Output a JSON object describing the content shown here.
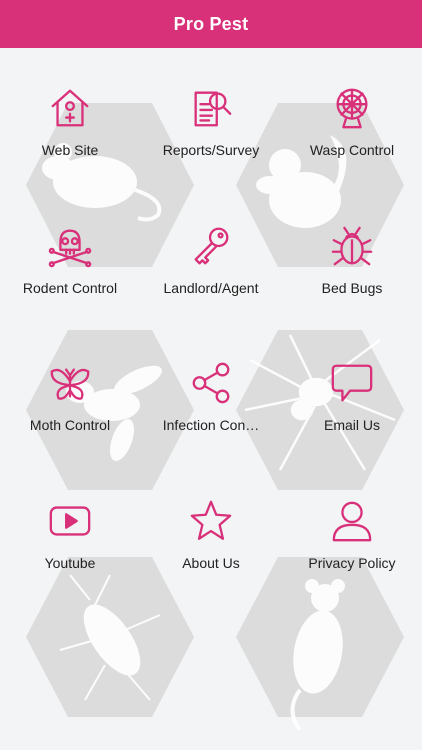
{
  "app": {
    "title": "Pro Pest"
  },
  "colors": {
    "accent": "#d9307a",
    "background": "#f2f4f5",
    "hexagon": "#dcdcdc"
  },
  "menu": [
    {
      "label": "Web Site",
      "icon": "house-icon"
    },
    {
      "label": "Reports/Survey",
      "icon": "report-search-icon"
    },
    {
      "label": "Wasp Control",
      "icon": "ferris-wheel-icon"
    },
    {
      "label": "Rodent Control",
      "icon": "skull-crossbones-icon"
    },
    {
      "label": "Landlord/Agent",
      "icon": "key-icon"
    },
    {
      "label": "Bed Bugs",
      "icon": "bug-icon"
    },
    {
      "label": "Moth Control",
      "icon": "butterfly-icon"
    },
    {
      "label": "Infection Con…",
      "icon": "share-icon"
    },
    {
      "label": "Email Us",
      "icon": "speech-bubble-icon"
    },
    {
      "label": "Youtube",
      "icon": "youtube-icon"
    },
    {
      "label": "About Us",
      "icon": "star-icon"
    },
    {
      "label": "Privacy Policy",
      "icon": "user-icon"
    }
  ]
}
